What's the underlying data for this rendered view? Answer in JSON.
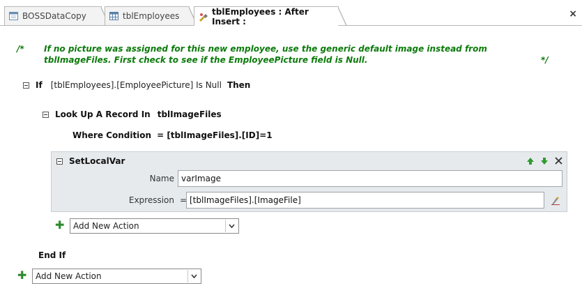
{
  "tabs": [
    {
      "label": "BOSSDataCopy",
      "icon": "table-form-icon"
    },
    {
      "label": "tblEmployees",
      "icon": "table-icon"
    },
    {
      "label": "tblEmployees : After Insert :",
      "icon": "macro-icon",
      "active": true
    }
  ],
  "close_label": "×",
  "comment": {
    "open": "/*",
    "text": "If no picture was assigned for this new employee, use the generic default image instead from tblImageFiles. First check to see if the EmployeePicture field is Null.",
    "close": "*/"
  },
  "if_block": {
    "keyword": "If",
    "condition": "[tblEmployees].[EmployeePicture] Is Null",
    "then": "Then",
    "end": "End If"
  },
  "lookup": {
    "label": "Look Up A Record In",
    "table": "tblImageFiles",
    "where_label": "Where Condition",
    "where_value": "= [tblImageFiles].[ID]=1"
  },
  "setlocalvar": {
    "title": "SetLocalVar",
    "name_label": "Name",
    "name_value": "varImage",
    "expression_label": "Expression",
    "expression_equals": "=",
    "expression_value": "[tblImageFiles].[ImageFile]"
  },
  "add_action": {
    "inner_value": "Add New Action",
    "outer_value": "Add New Action"
  },
  "colors": {
    "comment": "#0b7a0b",
    "plus": "#2e8b2e",
    "action_bg": "#e7eaed"
  }
}
